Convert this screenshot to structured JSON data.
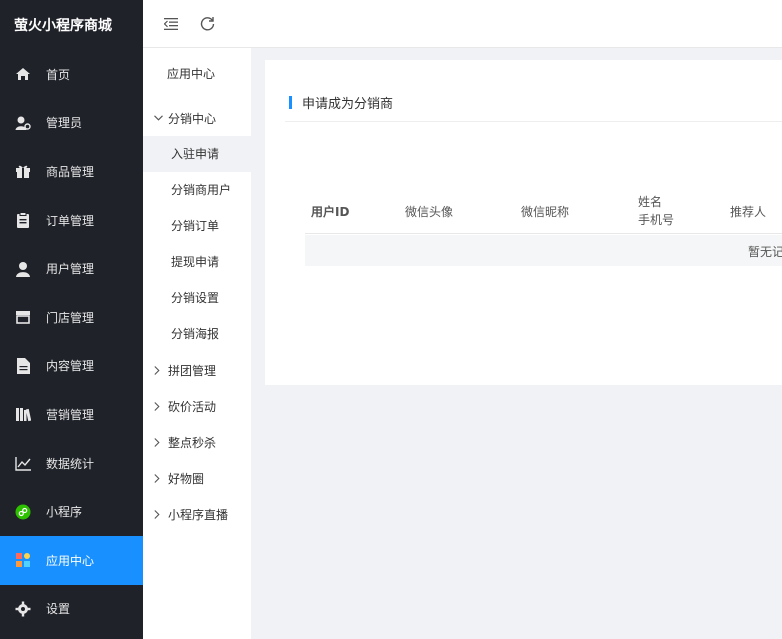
{
  "brand": "萤火小程序商城",
  "sidebar": {
    "items": [
      {
        "label": "首页",
        "icon": "home-icon"
      },
      {
        "label": "管理员",
        "icon": "admin-icon"
      },
      {
        "label": "商品管理",
        "icon": "gift-icon"
      },
      {
        "label": "订单管理",
        "icon": "clipboard-icon"
      },
      {
        "label": "用户管理",
        "icon": "user-icon"
      },
      {
        "label": "门店管理",
        "icon": "store-icon"
      },
      {
        "label": "内容管理",
        "icon": "document-icon"
      },
      {
        "label": "营销管理",
        "icon": "books-icon"
      },
      {
        "label": "数据统计",
        "icon": "line-chart-icon"
      },
      {
        "label": "小程序",
        "icon": "miniprogram-icon"
      },
      {
        "label": "应用中心",
        "icon": "apps-icon",
        "active": true
      },
      {
        "label": "设置",
        "icon": "gear-icon"
      }
    ]
  },
  "subnav": {
    "title": "应用中心",
    "group_open": "分销中心",
    "items": [
      "入驻申请",
      "分销商用户",
      "分销订单",
      "提现申请",
      "分销设置",
      "分销海报"
    ],
    "active_item": "入驻申请",
    "groups_closed": [
      "拼团管理",
      "砍价活动",
      "整点秒杀",
      "好物圈",
      "小程序直播"
    ]
  },
  "main": {
    "title": "申请成为分销商",
    "columns": [
      "用户ID",
      "微信头像",
      "微信昵称",
      "姓名",
      "手机号",
      "推荐人"
    ],
    "empty_text": "暂无记"
  },
  "colors": {
    "sidebar_bg": "#1f2229",
    "accent": "#1890ff",
    "miniprogram_green": "#2dc100"
  }
}
